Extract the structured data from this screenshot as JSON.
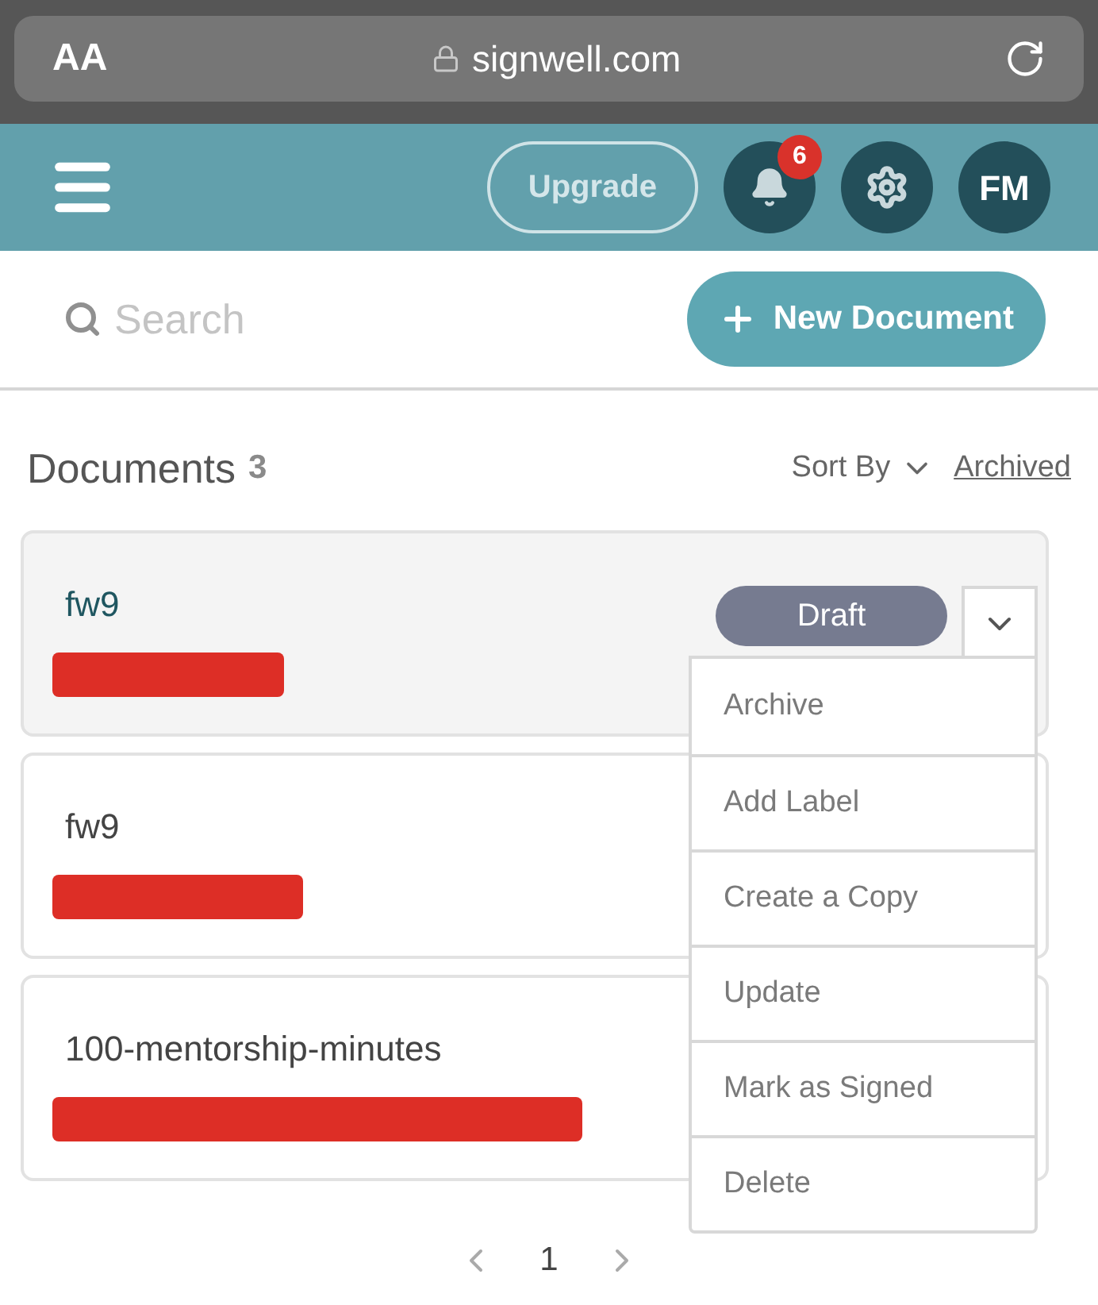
{
  "browser": {
    "text_size": "AA",
    "url": "signwell.com"
  },
  "header": {
    "upgrade": "Upgrade",
    "notifications": "6",
    "avatar": "FM"
  },
  "search": {
    "placeholder": "Search"
  },
  "new_document": "New Document",
  "documents": {
    "title": "Documents",
    "count": "3",
    "sort_by": "Sort By",
    "archived": "Archived",
    "items": [
      {
        "name": "fw9",
        "status": "Draft",
        "selected": true,
        "redacted": true,
        "menu_open": true
      },
      {
        "name": "fw9",
        "selected": false,
        "redacted": true,
        "menu_open": false
      },
      {
        "name": "100-mentorship-minutes",
        "selected": false,
        "redacted": true,
        "menu_open": false
      }
    ]
  },
  "menu": [
    "Archive",
    "Add Label",
    "Create a Copy",
    "Update",
    "Mark as Signed",
    "Delete"
  ],
  "pagination": {
    "page": "1"
  }
}
